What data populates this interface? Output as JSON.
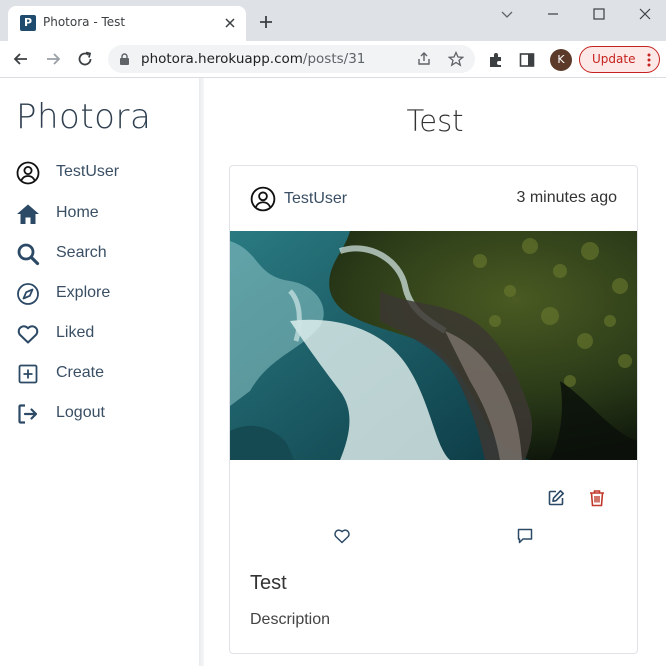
{
  "browser": {
    "tab_title": "Photora - Test",
    "favicon_letter": "P",
    "url_host": "photora.herokuapp.com",
    "url_path": "/posts/31",
    "profile_initial": "K",
    "update_label": "Update"
  },
  "sidebar": {
    "brand": "Photora",
    "items": [
      {
        "label": "TestUser",
        "icon": "user-circle-icon"
      },
      {
        "label": "Home",
        "icon": "home-icon"
      },
      {
        "label": "Search",
        "icon": "search-icon"
      },
      {
        "label": "Explore",
        "icon": "compass-icon"
      },
      {
        "label": "Liked",
        "icon": "heart-icon"
      },
      {
        "label": "Create",
        "icon": "plus-square-icon"
      },
      {
        "label": "Logout",
        "icon": "logout-icon"
      }
    ]
  },
  "main": {
    "page_title": "Test",
    "post": {
      "author": "TestUser",
      "time": "3 minutes ago",
      "title": "Test",
      "description": "Description",
      "image_subject": "aerial view of ocean waves meeting a forested coastline"
    }
  },
  "colors": {
    "brand_text": "#2f3f4f",
    "nav_text": "#3a4f64",
    "delete_red": "#c0392b",
    "update_red": "#c5221f"
  }
}
